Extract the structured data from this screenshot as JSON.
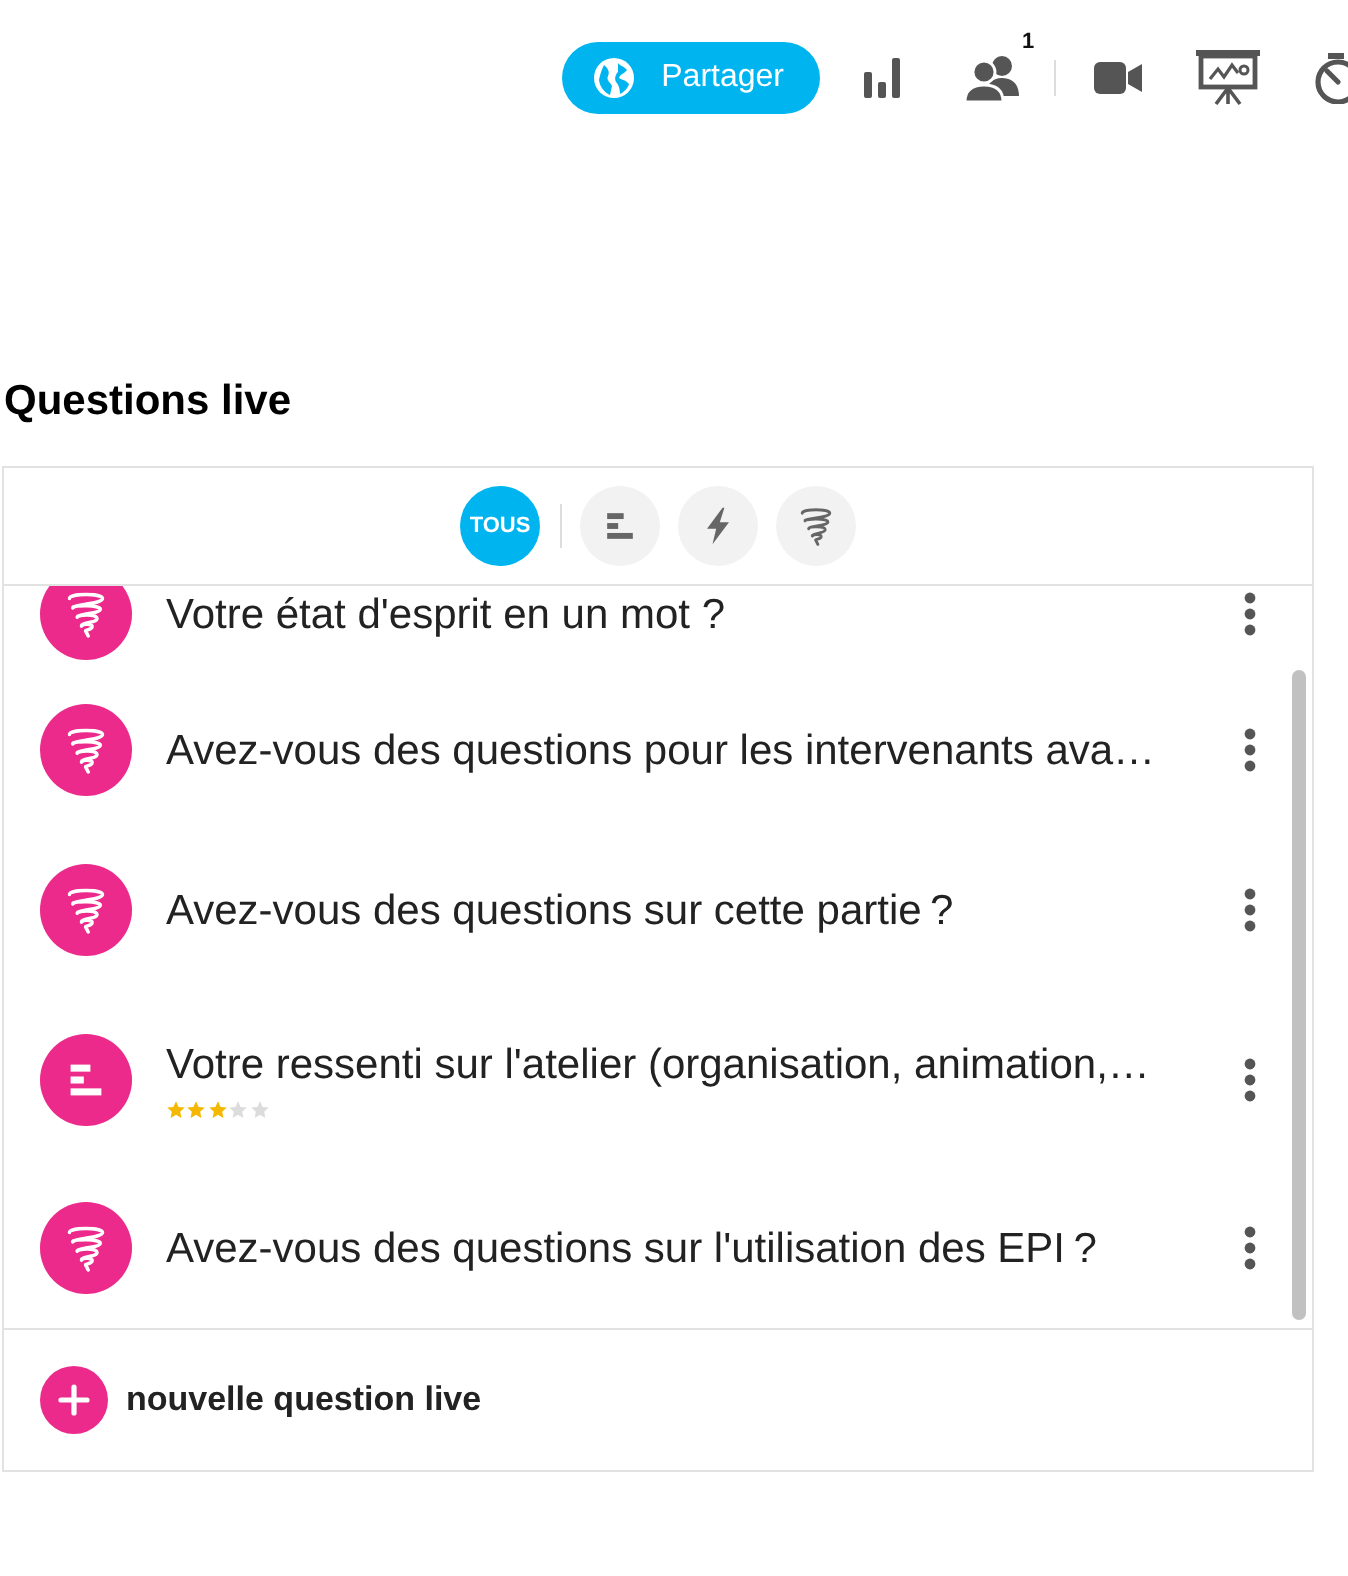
{
  "toolbar": {
    "share_button": {
      "label": "Partager"
    },
    "participant_count": "1"
  },
  "section": {
    "title": "Questions live",
    "filters": [
      {
        "kind": "all",
        "label": "TOUS",
        "selected": true
      },
      {
        "kind": "bars",
        "selected": false
      },
      {
        "kind": "lightning",
        "selected": false
      },
      {
        "kind": "spiral",
        "selected": false
      }
    ],
    "questions": [
      {
        "kind": "spiral",
        "text": "Votre état d'esprit en un mot ?"
      },
      {
        "kind": "spiral",
        "text": "Avez-vous des questions pour les intervenants ava…"
      },
      {
        "kind": "spiral",
        "text": "Avez-vous des questions sur cette partie ?"
      },
      {
        "kind": "bars",
        "text": "Votre ressenti sur l'atelier (organisation, animation,…",
        "stars": 3
      },
      {
        "kind": "spiral",
        "text": "Avez-vous des questions sur l'utilisation des EPI ?"
      }
    ],
    "new_question": {
      "label": "nouvelle question live"
    }
  }
}
